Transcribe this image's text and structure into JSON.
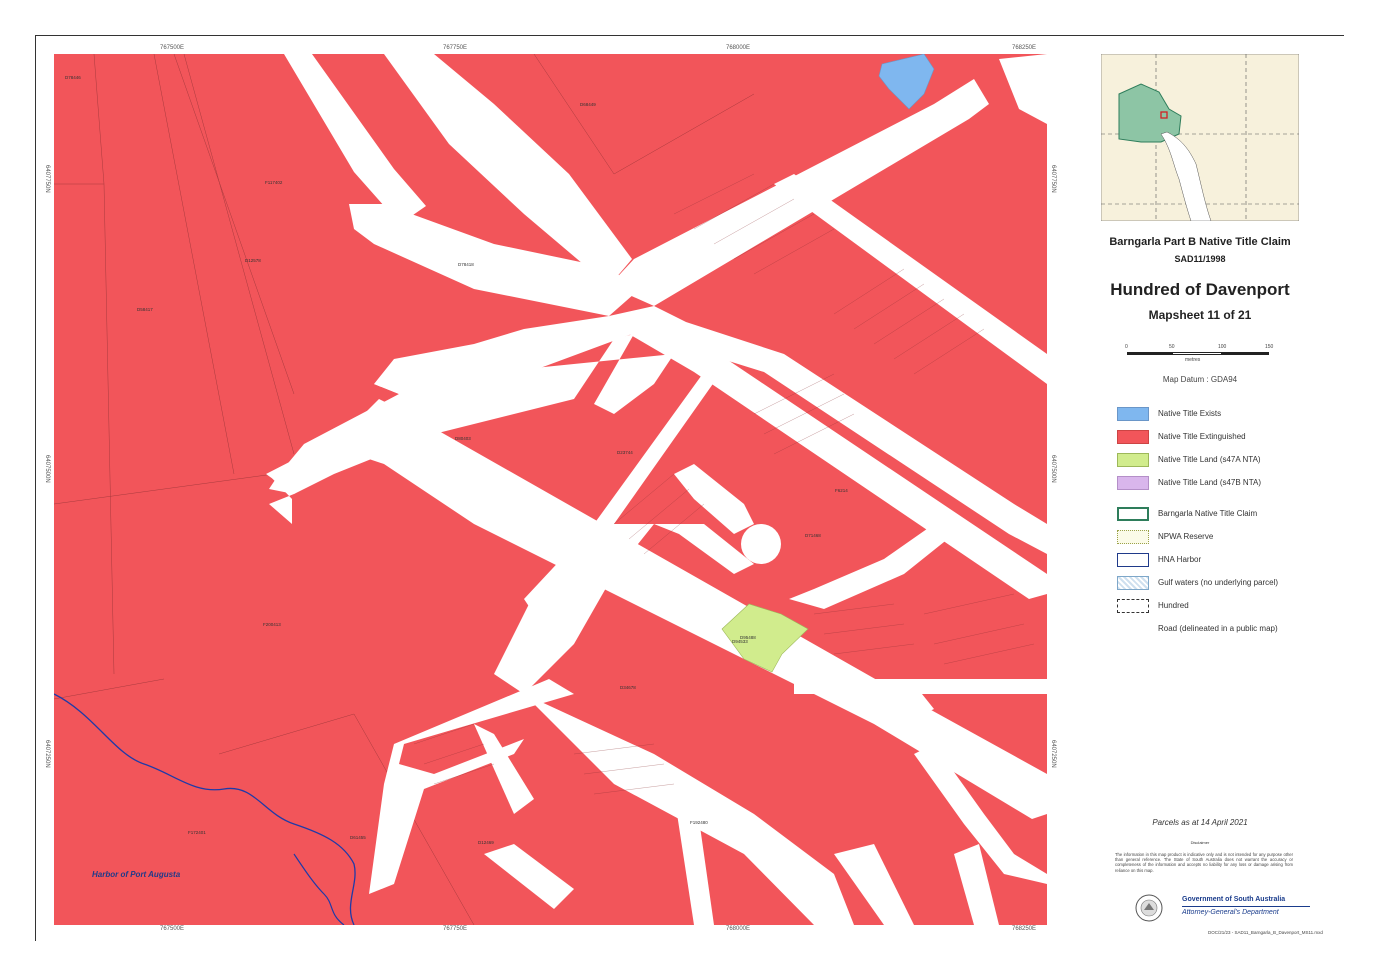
{
  "title": {
    "claim": "Barngarla Part B Native Title Claim",
    "claim_id": "SAD11/1998",
    "hundred": "Hundred of Davenport",
    "mapsheet": "Mapsheet 11 of 21"
  },
  "scale": {
    "ticks": [
      "0",
      "50",
      "100",
      "150"
    ],
    "unit": "metres"
  },
  "datum": "Map Datum : GDA94",
  "legend": [
    {
      "label": "Native Title Exists",
      "color": "#7fb7ef",
      "style": "fill"
    },
    {
      "label": "Native Title Extinguished",
      "color": "#f2555a",
      "style": "fill"
    },
    {
      "label": "Native Title Land (s47A NTA)",
      "color": "#d1ec8d",
      "style": "fill"
    },
    {
      "label": "Native Title Land (s47B NTA)",
      "color": "#d9b6ec",
      "style": "fill"
    },
    {
      "label": "Barngarla Native Title Claim",
      "color": "#2e7d5b",
      "style": "outline"
    },
    {
      "label": "NPWA Reserve",
      "color": "#9aa14a",
      "style": "dotted"
    },
    {
      "label": "HNA Harbor",
      "color": "#1f3a8a",
      "style": "outline"
    },
    {
      "label": "Gulf waters (no underlying parcel)",
      "color": "#7ea7c9",
      "style": "speckle"
    },
    {
      "label": "Hundred",
      "color": "#333333",
      "style": "dashed"
    },
    {
      "label": "Road (delineated in a public map)",
      "color": "#ffffff",
      "style": "plain"
    }
  ],
  "parcels_date": "Parcels as at 14 April 2021",
  "disclaimer_title": "Disclaimer",
  "disclaimer": "The information in this map product is indicative only and is not intended for any purpose other than general reference. The State of South Australia does not warrant the accuracy or completeness of the information and accepts no liability for any loss or damage arising from reliance on this map.",
  "government": {
    "name": "Government of South Australia",
    "dept": "Attorney-General's Department"
  },
  "file_ref": "DOC/21/23 - SAD11_Barngarla_B_Davenport_MS11.mxd",
  "harbor_label": "Harbor of Port Augusta",
  "grid": {
    "top": [
      "767500E",
      "767750E",
      "768000E",
      "768250E"
    ],
    "bottom": [
      "767500E",
      "767750E",
      "768000E",
      "768250E"
    ],
    "left": [
      "6407750N",
      "6407500N",
      "6407250N"
    ],
    "right": [
      "6407750N",
      "6407500N",
      "6407250N"
    ]
  },
  "parcel_labels": [
    "D78446",
    "D68449",
    "F117402",
    "D12578",
    "D58417",
    "D78418",
    "D80403",
    "F200413",
    "D34678",
    "F6214",
    "D95488",
    "D71468",
    "F172401",
    "D61455",
    "D12469",
    "F192480",
    "D94533",
    "D23744"
  ],
  "colors": {
    "extinguished": "#f2555a",
    "exists": "#7fb7ef",
    "s47a": "#d1ec8d",
    "road": "#ffffff",
    "harbor_line": "#1f3aa8",
    "claim_fill": "#8dc5a5",
    "claim_line": "#2e7d5b"
  }
}
